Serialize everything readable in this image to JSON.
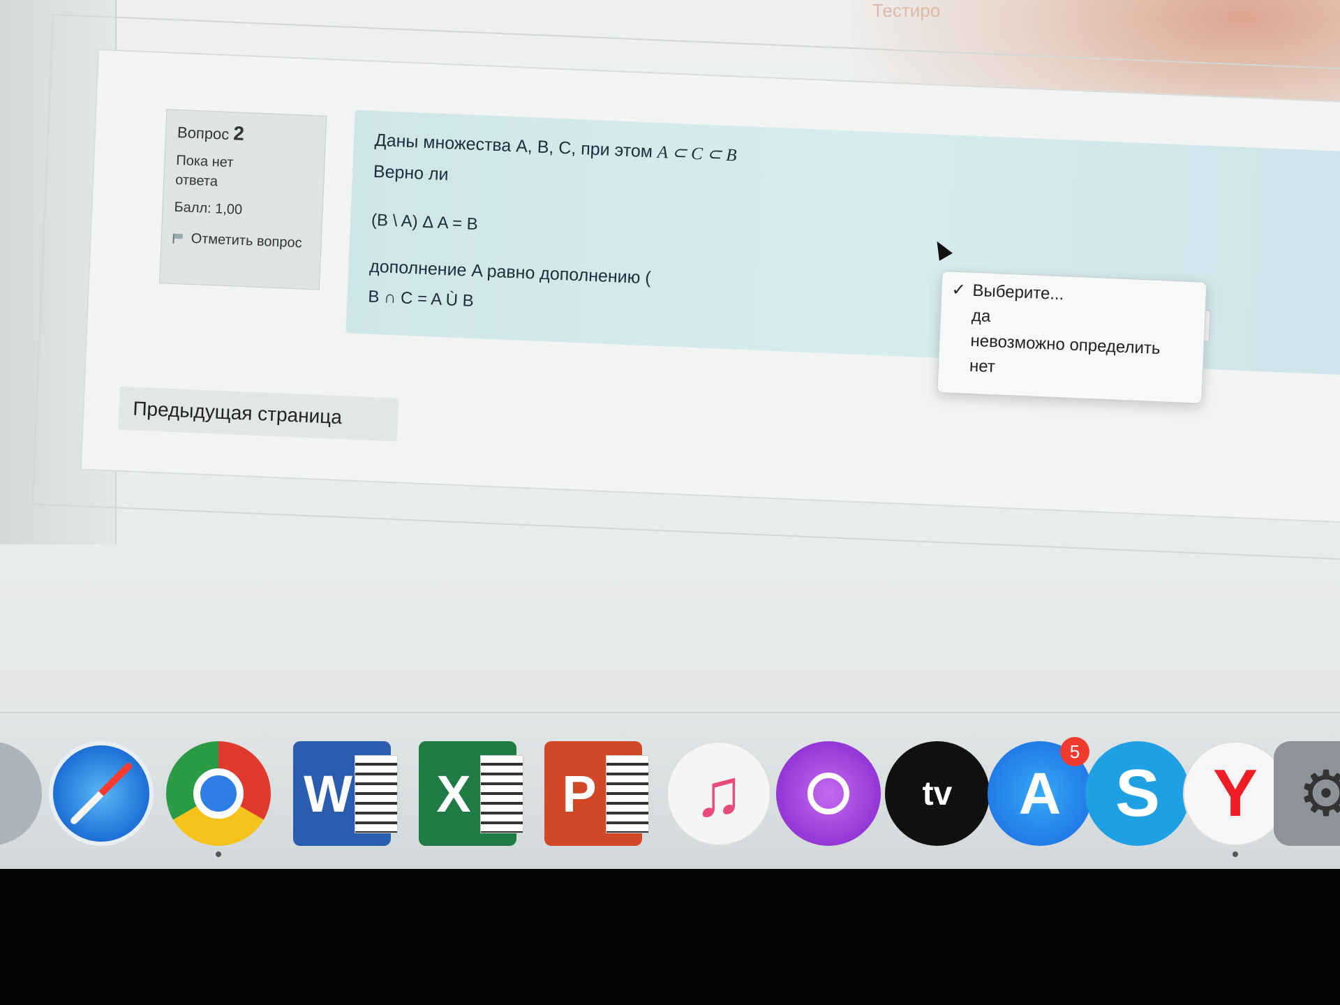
{
  "header": {
    "top_hint": "Тестиро"
  },
  "question_info": {
    "title": "Вопрос",
    "number": "2",
    "state": "Пока нет ответа",
    "grade": "Балл: 1,00",
    "flag_label": "Отметить вопрос"
  },
  "question": {
    "line1_text": "Даны множества A, B, C, при этом",
    "line1_math": "A ⊂ C ⊂ B",
    "line2": "Верно ли",
    "line3": "(B \\ A) Δ A = B",
    "line4": "дополнение  A равно дополнению (",
    "line5": "B ∩ C = A Ù B"
  },
  "dropdown": {
    "check_glyph": "✓",
    "options": [
      "Выберите...",
      "да",
      "невозможно определить",
      "нет"
    ],
    "selected": "Выберите..."
  },
  "navigation": {
    "prev_button": "Предыдущая страница"
  },
  "dock": {
    "apps": [
      {
        "name": "finder-icon"
      },
      {
        "name": "safari-icon"
      },
      {
        "name": "chrome-icon",
        "running": true
      },
      {
        "name": "word-icon",
        "letter": "W"
      },
      {
        "name": "excel-icon",
        "letter": "X"
      },
      {
        "name": "powerpoint-icon",
        "letter": "P"
      },
      {
        "name": "music-icon",
        "glyph": "♫"
      },
      {
        "name": "podcasts-icon"
      },
      {
        "name": "appletv-icon",
        "label": "tv"
      },
      {
        "name": "appstore-icon",
        "letter": "A",
        "badge": "5"
      },
      {
        "name": "skype-icon",
        "letter": "S"
      },
      {
        "name": "yandex-browser-icon",
        "letter": "Y",
        "running": true
      },
      {
        "name": "system-preferences-icon",
        "glyph": "⚙"
      }
    ]
  }
}
